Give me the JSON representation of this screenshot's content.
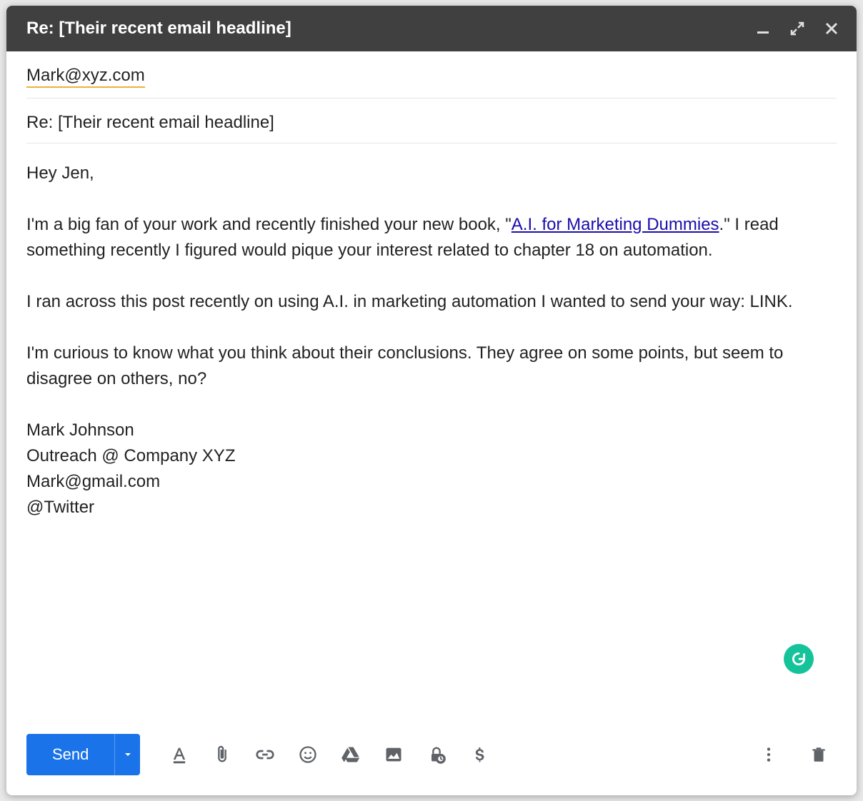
{
  "header": {
    "title": "Re: [Their recent email headline]"
  },
  "fields": {
    "recipient": "Mark@xyz.com",
    "subject": "Re: [Their recent email headline]"
  },
  "body": {
    "greeting": "Hey Jen,",
    "p1_before_link": "I'm a big fan of your work and recently finished your new book, \"",
    "p1_link_text": "A.I. for Marketing Dummies",
    "p1_after_link": ".\" I read something recently I figured would pique your interest related to chapter 18 on automation.",
    "p2": "I ran across this post recently on using A.I. in marketing automation I wanted to send your way: LINK.",
    "p3": "I'm curious to know what you think about their conclusions. They agree on some points, but seem to disagree on others, no?",
    "sig1": "Mark Johnson",
    "sig2": "Outreach @ Company XYZ",
    "sig3": "Mark@gmail.com",
    "sig4": "@Twitter"
  },
  "footer": {
    "send_label": "Send"
  },
  "icons": {
    "minimize": "minimize",
    "expand": "expand",
    "close": "close",
    "format": "format",
    "attach": "attach",
    "link": "link",
    "emoji": "emoji",
    "drive": "drive",
    "photo": "photo",
    "confidential": "confidential",
    "money": "money",
    "more": "more",
    "delete": "delete",
    "grammarly": "grammarly"
  }
}
